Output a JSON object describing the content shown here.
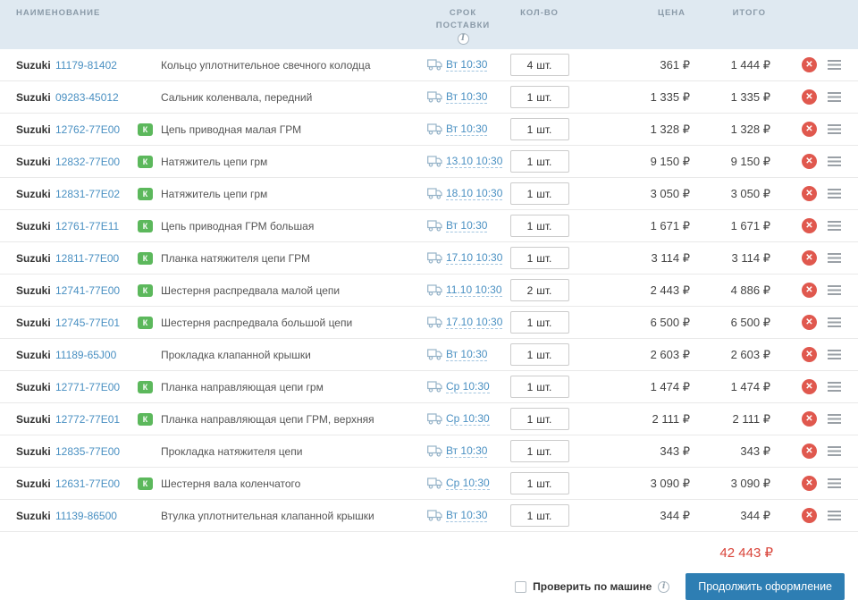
{
  "header": {
    "name": "НАИМЕНОВАНИЕ",
    "delivery_line1": "СРОК",
    "delivery_line2": "ПОСТАВКИ",
    "qty": "КОЛ-ВО",
    "price": "ЦЕНА",
    "total": "ИТОГО"
  },
  "icons": {
    "info_glyph": "i",
    "badge_glyph": "К",
    "delete_glyph": "✕"
  },
  "colors": {
    "header_bg": "#dfe9f1",
    "link": "#4a90c2",
    "badge_green": "#5cb85c",
    "delete_red": "#e0584e",
    "grand_total_red": "#d9443a",
    "button_bg": "#2e7eb3"
  },
  "rows": [
    {
      "brand": "Suzuki",
      "part": "11179-81402",
      "badge": false,
      "desc": "Кольцо уплотнительное свечного колодца",
      "date": "Вт 10:30",
      "qty": "4",
      "unit": "шт.",
      "price": "361 ₽",
      "total": "1 444 ₽"
    },
    {
      "brand": "Suzuki",
      "part": "09283-45012",
      "badge": false,
      "desc": "Сальник коленвала, передний",
      "date": "Вт 10:30",
      "qty": "1",
      "unit": "шт.",
      "price": "1 335 ₽",
      "total": "1 335 ₽"
    },
    {
      "brand": "Suzuki",
      "part": "12762-77E00",
      "badge": true,
      "desc": "Цепь приводная малая ГРМ",
      "date": "Вт 10:30",
      "qty": "1",
      "unit": "шт.",
      "price": "1 328 ₽",
      "total": "1 328 ₽"
    },
    {
      "brand": "Suzuki",
      "part": "12832-77E00",
      "badge": true,
      "desc": "Натяжитель цепи грм",
      "date": "13.10 10:30",
      "qty": "1",
      "unit": "шт.",
      "price": "9 150 ₽",
      "total": "9 150 ₽"
    },
    {
      "brand": "Suzuki",
      "part": "12831-77E02",
      "badge": true,
      "desc": "Натяжитель цепи грм",
      "date": "18.10 10:30",
      "qty": "1",
      "unit": "шт.",
      "price": "3 050 ₽",
      "total": "3 050 ₽"
    },
    {
      "brand": "Suzuki",
      "part": "12761-77E11",
      "badge": true,
      "desc": "Цепь приводная ГРМ большая",
      "date": "Вт 10:30",
      "qty": "1",
      "unit": "шт.",
      "price": "1 671 ₽",
      "total": "1 671 ₽"
    },
    {
      "brand": "Suzuki",
      "part": "12811-77E00",
      "badge": true,
      "desc": "Планка натяжителя цепи ГРМ",
      "date": "17.10 10:30",
      "qty": "1",
      "unit": "шт.",
      "price": "3 114 ₽",
      "total": "3 114 ₽"
    },
    {
      "brand": "Suzuki",
      "part": "12741-77E00",
      "badge": true,
      "desc": "Шестерня распредвала малой цепи",
      "date": "11.10 10:30",
      "qty": "2",
      "unit": "шт.",
      "price": "2 443 ₽",
      "total": "4 886 ₽"
    },
    {
      "brand": "Suzuki",
      "part": "12745-77E01",
      "badge": true,
      "desc": "Шестерня распредвала большой цепи",
      "date": "17.10 10:30",
      "qty": "1",
      "unit": "шт.",
      "price": "6 500 ₽",
      "total": "6 500 ₽"
    },
    {
      "brand": "Suzuki",
      "part": "11189-65J00",
      "badge": false,
      "desc": "Прокладка клапанной крышки",
      "date": "Вт 10:30",
      "qty": "1",
      "unit": "шт.",
      "price": "2 603 ₽",
      "total": "2 603 ₽"
    },
    {
      "brand": "Suzuki",
      "part": "12771-77E00",
      "badge": true,
      "desc": "Планка направляющая цепи грм",
      "date": "Ср 10:30",
      "qty": "1",
      "unit": "шт.",
      "price": "1 474 ₽",
      "total": "1 474 ₽"
    },
    {
      "brand": "Suzuki",
      "part": "12772-77E01",
      "badge": true,
      "desc": "Планка направляющая цепи ГРМ, верхняя",
      "date": "Ср 10:30",
      "qty": "1",
      "unit": "шт.",
      "price": "2 111 ₽",
      "total": "2 111 ₽"
    },
    {
      "brand": "Suzuki",
      "part": "12835-77E00",
      "badge": false,
      "desc": "Прокладка натяжителя цепи",
      "date": "Вт 10:30",
      "qty": "1",
      "unit": "шт.",
      "price": "343 ₽",
      "total": "343 ₽"
    },
    {
      "brand": "Suzuki",
      "part": "12631-77E00",
      "badge": true,
      "desc": "Шестерня вала коленчатого",
      "date": "Ср 10:30",
      "qty": "1",
      "unit": "шт.",
      "price": "3 090 ₽",
      "total": "3 090 ₽"
    },
    {
      "brand": "Suzuki",
      "part": "11139-86500",
      "badge": false,
      "desc": "Втулка уплотнительная клапанной крышки",
      "date": "Вт 10:30",
      "qty": "1",
      "unit": "шт.",
      "price": "344 ₽",
      "total": "344 ₽"
    }
  ],
  "footer": {
    "grand_total": "42 443 ₽",
    "checkbox_label": "Проверить по машине",
    "button_label": "Продолжить оформление"
  }
}
